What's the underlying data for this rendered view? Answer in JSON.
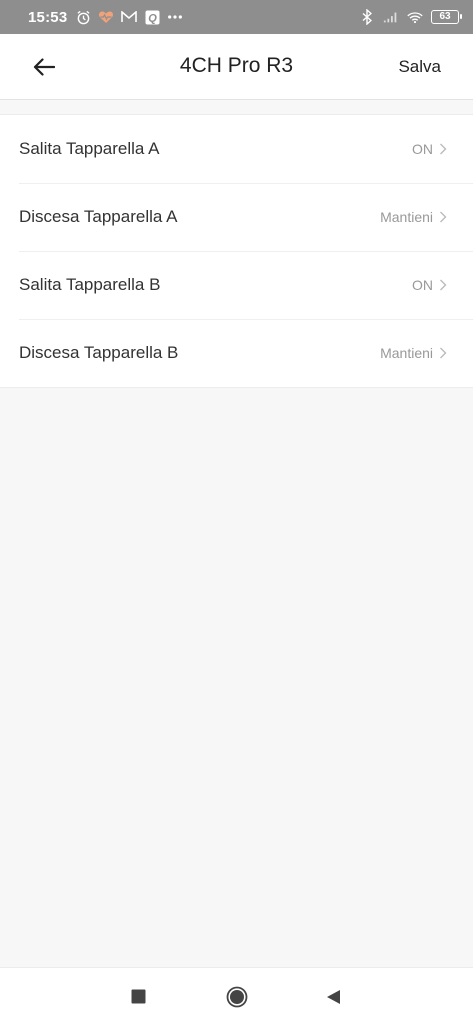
{
  "status_bar": {
    "time": "15:53",
    "battery": "63",
    "icons": [
      "alarm-icon",
      "health-icon",
      "mail-icon",
      "q-app-icon",
      "more-dots-icon",
      "bluetooth-icon",
      "signal-icon",
      "wifi-icon",
      "battery-icon"
    ]
  },
  "header": {
    "title": "4CH Pro R3",
    "save_label": "Salva",
    "back_icon": "arrow-left-icon"
  },
  "settings": [
    {
      "label": "Salita Tapparella A",
      "value": "ON"
    },
    {
      "label": "Discesa Tapparella A",
      "value": "Mantieni"
    },
    {
      "label": "Salita Tapparella B",
      "value": "ON"
    },
    {
      "label": "Discesa Tapparella B",
      "value": "Mantieni"
    }
  ],
  "nav_bar": {
    "icons": [
      "recents-square-icon",
      "home-circle-icon",
      "back-triangle-icon"
    ]
  },
  "colors": {
    "status_bar_bg": "#8e8e8e",
    "page_bg": "#f7f7f7",
    "value_text": "#999999"
  }
}
